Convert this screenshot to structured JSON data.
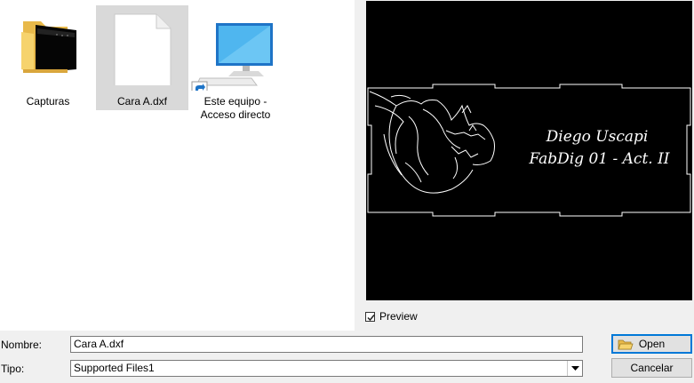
{
  "files": [
    {
      "name": "Capturas",
      "icon": "folder-icon",
      "selected": false
    },
    {
      "name": "Cara A.dxf",
      "icon": "document-icon",
      "selected": true
    },
    {
      "name_line1": "Este equipo -",
      "name_line2": "Acceso directo",
      "icon": "computer-shortcut-icon",
      "selected": false
    }
  ],
  "preview": {
    "checkbox_label": "Preview",
    "checked": true,
    "text_line1": "Diego Uscapi",
    "text_line2": "FabDig 01 - Act. II"
  },
  "form": {
    "name_label": "Nombre:",
    "name_value": "Cara A.dxf",
    "type_label": "Tipo:",
    "type_value": "Supported Files1"
  },
  "buttons": {
    "open": "Open",
    "cancel": "Cancelar"
  },
  "colors": {
    "selection": "#d9d9d9",
    "preview_bg": "#000000",
    "accent": "#0078d7"
  }
}
